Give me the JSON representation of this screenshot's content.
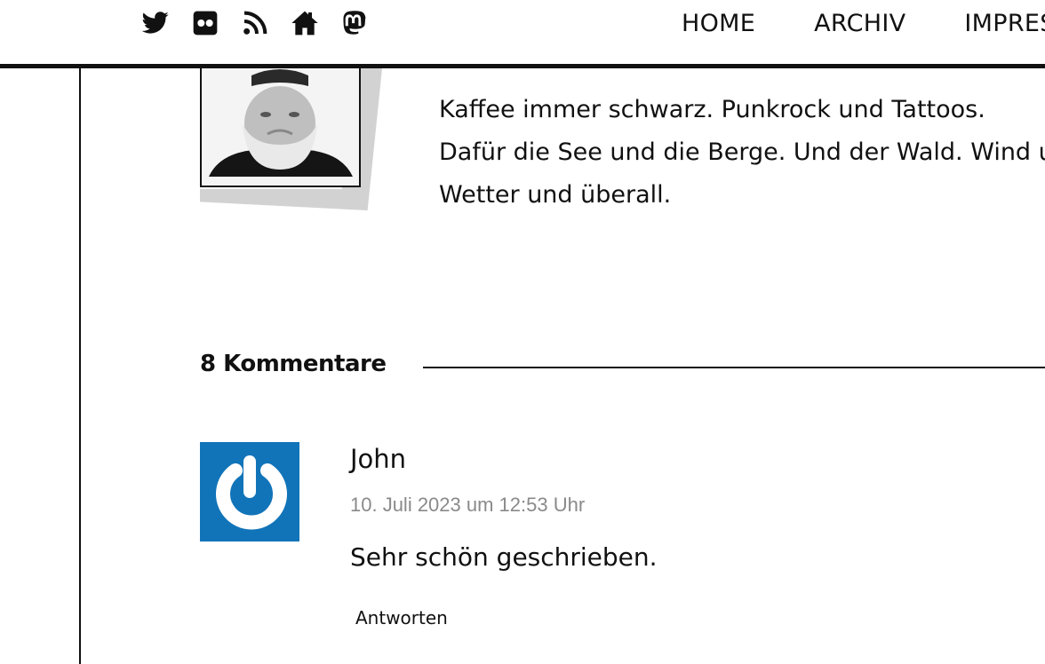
{
  "header": {
    "social_icons": [
      "twitter-icon",
      "flickr-icon",
      "rss-icon",
      "home-icon",
      "mastodon-icon"
    ],
    "nav": [
      {
        "label": "HOME"
      },
      {
        "label": "ARCHIV"
      },
      {
        "label": "IMPRESSUM"
      }
    ]
  },
  "author": {
    "bio_lines": [
      "Kaffee immer schwarz. Punkrock und Tattoos.",
      "Dafür die See und die Berge. Und der Wald. Wind und",
      "Wetter und überall."
    ]
  },
  "comments": {
    "title": "8 Kommentare",
    "items": [
      {
        "author": "John",
        "date": "10. Juli 2023 um 12:53 Uhr",
        "text": "Sehr schön geschrieben.",
        "reply_label": "Antworten",
        "avatar_icon": "gravatar-icon"
      }
    ]
  },
  "colors": {
    "text": "#111111",
    "date": "#8a8a8a",
    "avatar_bg": "#1174b9",
    "photo_shadow": "#d2d2d2"
  }
}
